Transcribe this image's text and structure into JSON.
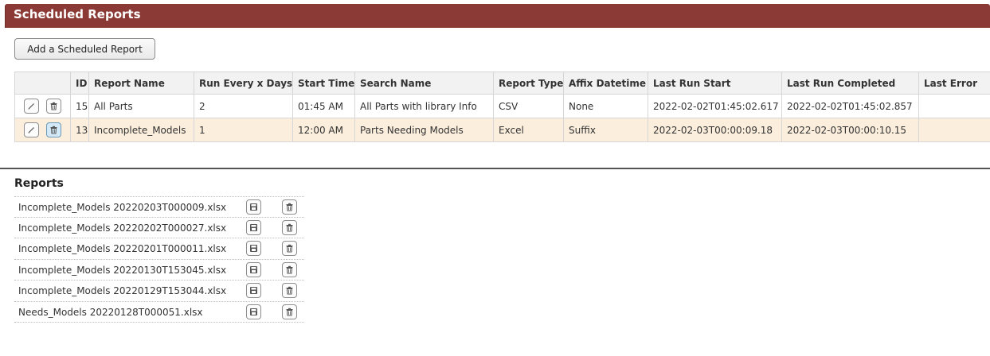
{
  "header": {
    "title": "Scheduled Reports"
  },
  "toolbar": {
    "add_label": "Add a Scheduled Report"
  },
  "schedule_table": {
    "columns": [
      "",
      "ID",
      "Report Name",
      "Run Every x Days",
      "Start Time",
      "Search Name",
      "Report Type",
      "Affix Datetime",
      "Last Run Start",
      "Last Run Completed",
      "Last Error"
    ],
    "rows": [
      {
        "id": "15",
        "report_name": "All Parts",
        "run_every": "2",
        "start_time": "01:45 AM",
        "search_name": "All Parts with library Info",
        "report_type": "CSV",
        "affix": "None",
        "last_start": "2022-02-02T01:45:02.617",
        "last_completed": "2022-02-02T01:45:02.857",
        "last_error": ""
      },
      {
        "id": "13",
        "report_name": "Incomplete_Models",
        "run_every": "1",
        "start_time": "12:00 AM",
        "search_name": "Parts Needing Models",
        "report_type": "Excel",
        "affix": "Suffix",
        "last_start": "2022-02-03T00:00:09.18",
        "last_completed": "2022-02-03T00:00:10.15",
        "last_error": ""
      }
    ]
  },
  "reports": {
    "title": "Reports",
    "files": [
      "Incomplete_Models 20220203T000009.xlsx",
      "Incomplete_Models 20220202T000027.xlsx",
      "Incomplete_Models 20220201T000011.xlsx",
      "Incomplete_Models 20220130T153045.xlsx",
      "Incomplete_Models 20220129T153044.xlsx",
      "Needs_Models 20220128T000051.xlsx"
    ]
  },
  "icons": {
    "edit": "pencil-icon",
    "delete": "trash-icon",
    "download": "save-icon"
  },
  "colors": {
    "header_bg": "#8b3a35",
    "highlight_row": "#fbeedd",
    "highlight_button": "#d3e9f7"
  }
}
